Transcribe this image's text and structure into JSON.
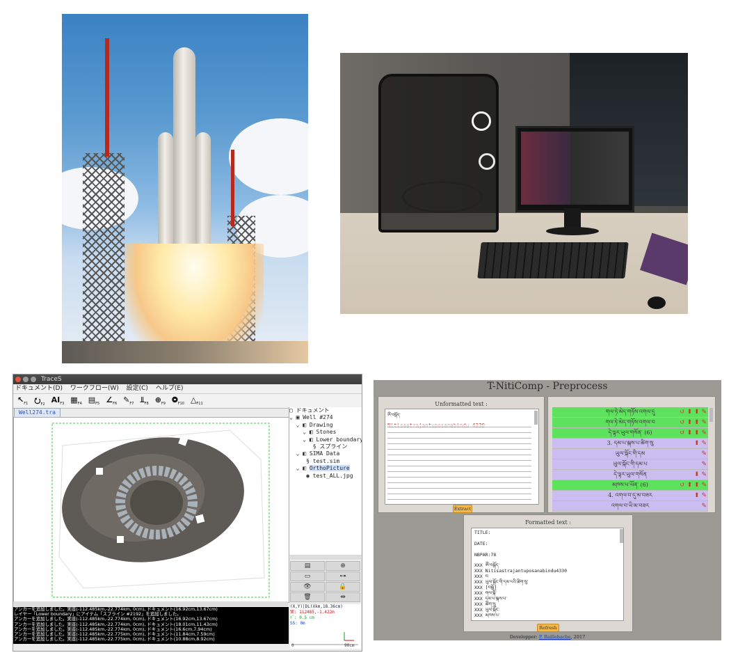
{
  "traces": {
    "window_title": "TraceS",
    "menu": [
      "ドキュメント(D)",
      "ワークフロー(W)",
      "設定(C)",
      "ヘルプ(E)"
    ],
    "tools": [
      {
        "glyph": "↖",
        "key": "F1"
      },
      {
        "glyph": "⭮",
        "key": "F2"
      },
      {
        "glyph": "AI",
        "key": "F3"
      },
      {
        "glyph": "▦",
        "key": "F4"
      },
      {
        "glyph": "▤",
        "key": "F5"
      },
      {
        "glyph": "∠",
        "key": "F6"
      },
      {
        "glyph": "✎",
        "key": "F7"
      },
      {
        "glyph": "⫫",
        "key": "F8"
      },
      {
        "glyph": "⊕",
        "key": "F9"
      },
      {
        "glyph": "⭗",
        "key": "F10"
      },
      {
        "glyph": "△",
        "key": "F11"
      }
    ],
    "file_tab": "Well274.tra",
    "tree": [
      {
        "indent": 0,
        "label": "ドキュメント"
      },
      {
        "indent": 0,
        "label": "Well #274"
      },
      {
        "indent": 1,
        "label": "Drawing"
      },
      {
        "indent": 2,
        "label": "Stones"
      },
      {
        "indent": 2,
        "label": "Lower boundary"
      },
      {
        "indent": 3,
        "label": "スプライン"
      },
      {
        "indent": 1,
        "label": "SIMA Data"
      },
      {
        "indent": 2,
        "label": "test.sim"
      },
      {
        "indent": 1,
        "label": "OrthoPicture"
      },
      {
        "indent": 2,
        "label": "test_ALL.jpg"
      }
    ],
    "console_lines": [
      "アンカーを追加しました。実座(-112.485km,-22.774km, 0cm), ドキュメント(16.92cm,13.67cm)",
      "レイヤー「Lower boundary」にアイテム「スプライン #2192」を追加しました。",
      "アンカーを追加しました。実座(-112.485km,-22.774km, 0cm), ドキュメント(16.92cm,13.67cm)",
      "アンカーを追加しました。実座(-112.485km,-22.774km, 0cm), ドキュメント(18.01cm,11.43cm)",
      "アンカーを追加しました。実座(-112.485km,-22.774km, 0cm), ドキュメント(16.6cm,7.94cm)",
      "アンカーを追加しました。実座(-112.485km,-22.775km, 0cm), ドキュメント(11.84cm,7.59cm)",
      "アンカーを追加しました。実座(-112.485km,-22.775km, 0cm), ドキュメント(10.88cm,8.92cm)"
    ],
    "coord_lines": [
      "(X,Y)|DL(Xkm,18.36cm)",
      "実: 112485,-1.422m",
      "ﾄﾞ: 0.5 cm",
      "SS: 0m"
    ],
    "scale_labels": [
      "0",
      "90cm"
    ]
  },
  "niti": {
    "title": "T-NitiComp - Preprocess",
    "unformatted_title": "Unformatted text :",
    "unformatted_header": "Nitisastrajantuposanabindu 4330",
    "extract_label": "Extract",
    "formatted_title": "Formatted text :",
    "formatted_lines": [
      "TITLE:",
      "",
      "DATE:",
      "",
      "NBPAR:78",
      "",
      "XXX ༀ་བསྒོད་",
      "XXX Nitisastrajantuposanabindu4330",
      "XXX བ",
      "XXX ཡུལ་སྐོང་གི་དམ་པའི་ཚིག་སུ་",
      "XXX [བསྒོ]",
      "XXX གལ་སྐོ་",
      "XXX དམ་པ་མྐས་པ་",
      "XXX ཚིག་སུ",
      "XXX ཡུལ་སྐོང་",
      "XXX མཁས་པ་"
    ],
    "refresh_label": "Refresh",
    "footer_prefix": "Developper: ",
    "footer_author": "P. Baillehache",
    "footer_suffix": ", 2017",
    "rows": [
      {
        "text": "གལ་ཏེ་མེད་གཏོས་འགལ་དུ",
        "color": "green",
        "actions": "↺ ⬆ ⬆ ✎"
      },
      {
        "text": "གལ་ཏེ་མེད་གཏོས་འགལ་བ",
        "color": "green",
        "actions": "↺ ⬆ ⬆ ✎"
      },
      {
        "text": "དེ་ལྟར་ཡུལ་གསོན་ (6)",
        "color": "green",
        "actions": "↺ ⬆ ⬆ ✎"
      },
      {
        "text": "3. དམ་པ་མྐས་པ་ཚིག་སུ",
        "color": "purple",
        "actions": "⬆ ✎"
      },
      {
        "text": "ཡུལ་སྐོང་གི་དམ",
        "color": "purple",
        "actions": "✎"
      },
      {
        "text": "ཡུལ་སྐོང་གི་དམ་པ",
        "color": "purple",
        "actions": "✎"
      },
      {
        "text": "དེ་ལྟར་ཡུལ་གསོན",
        "color": "purple",
        "actions": "⬇ ✎"
      },
      {
        "text": "མཁས་པ་ཡོན་ (6)",
        "color": "green",
        "actions": "↺ ⬆ ⬆ ✎"
      },
      {
        "text": "4. འགལ་བ་དུ་མ་བཟར",
        "color": "purple",
        "actions": "⬆ ✎"
      },
      {
        "text": "འགལ་བ་ཡི་མ་བཟར",
        "color": "purple",
        "actions": "✎"
      }
    ]
  }
}
